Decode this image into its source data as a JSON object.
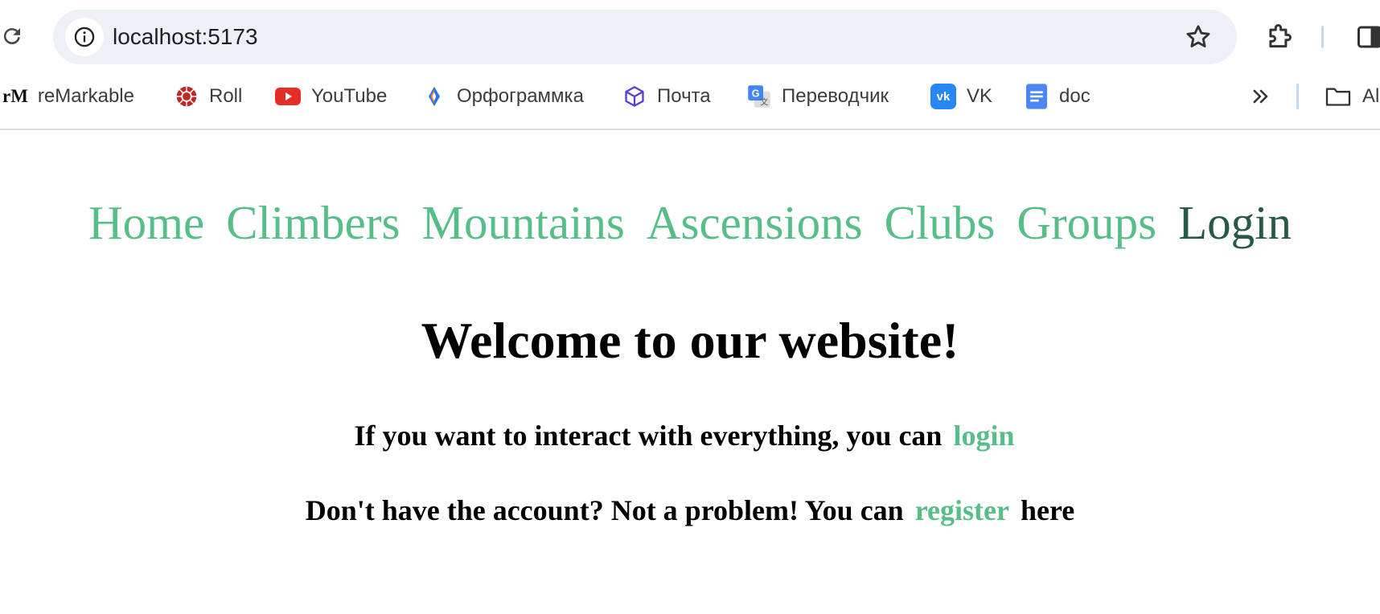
{
  "browser": {
    "url": "localhost:5173",
    "bookmarks": [
      {
        "label": "reMarkable",
        "icon": "remarkable-icon"
      },
      {
        "label": "Roll",
        "icon": "roll-icon"
      },
      {
        "label": "YouTube",
        "icon": "youtube-icon"
      },
      {
        "label": "Орфограммка",
        "icon": "orfogrammka-icon"
      },
      {
        "label": "Почта",
        "icon": "mail-icon"
      },
      {
        "label": "Переводчик",
        "icon": "translate-icon"
      },
      {
        "label": "VK",
        "icon": "vk-icon"
      },
      {
        "label": "doc",
        "icon": "docs-icon"
      }
    ],
    "bookmark_folder": {
      "label": "Al",
      "icon": "folder-icon"
    },
    "remarkable_logo_text": "rM",
    "vk_logo_text": "vk"
  },
  "nav": {
    "items": [
      {
        "label": "Home"
      },
      {
        "label": "Climbers"
      },
      {
        "label": "Mountains"
      },
      {
        "label": "Ascensions"
      },
      {
        "label": "Clubs"
      },
      {
        "label": "Groups"
      },
      {
        "label": "Login"
      }
    ],
    "current": "Login"
  },
  "content": {
    "welcome": "Welcome to our website!",
    "line1_text": "If you want to interact with everything, you can",
    "line1_link": "login",
    "line2_text": "Don't have the account? Not a problem! You can",
    "line2_link": "register",
    "line2_suffix": "here"
  },
  "colors": {
    "link": "#57bd89",
    "link_current": "#285944",
    "omnibox": "#edf0f6"
  }
}
